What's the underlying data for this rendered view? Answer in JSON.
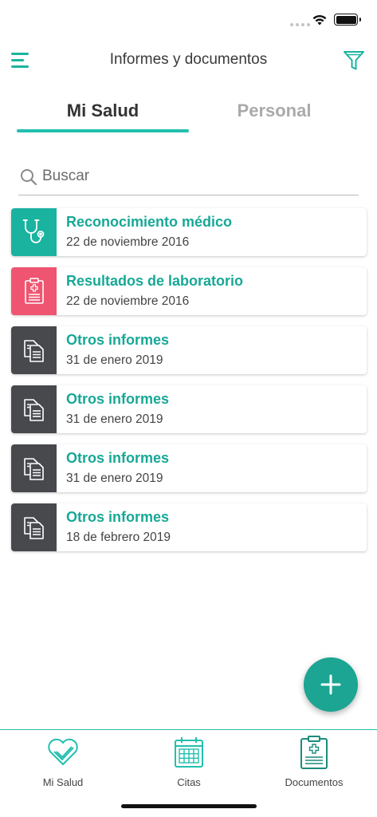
{
  "header": {
    "title": "Informes y documentos"
  },
  "tabs": [
    {
      "label": "Mi Salud",
      "active": true
    },
    {
      "label": "Personal",
      "active": false
    }
  ],
  "search": {
    "placeholder": "Buscar",
    "value": ""
  },
  "documents": [
    {
      "title": "Reconocimiento médico",
      "date": "22 de noviembre 2016",
      "icon": "stethoscope-icon",
      "color": "#1ab3a0"
    },
    {
      "title": "Resultados de laboratorio",
      "date": "22 de noviembre 2016",
      "icon": "clipboard-medical-icon",
      "color": "#ef5570"
    },
    {
      "title": "Otros informes",
      "date": "31 de enero 2019",
      "icon": "documents-icon",
      "color": "#47494d"
    },
    {
      "title": "Otros informes",
      "date": "31 de enero 2019",
      "icon": "documents-icon",
      "color": "#47494d"
    },
    {
      "title": "Otros informes",
      "date": "31 de enero 2019",
      "icon": "documents-icon",
      "color": "#47494d"
    },
    {
      "title": "Otros informes",
      "date": "18 de febrero 2019",
      "icon": "documents-icon",
      "color": "#47494d"
    }
  ],
  "fab": {
    "label": "+"
  },
  "tab_bar": [
    {
      "label": "Mi Salud",
      "icon": "heart-check-icon"
    },
    {
      "label": "Citas",
      "icon": "calendar-icon"
    },
    {
      "label": "Documentos",
      "icon": "clipboard-icon"
    }
  ],
  "colors": {
    "accent": "#1ab3a0",
    "fab": "#1ba592",
    "lab": "#ef5570",
    "dark": "#47494d"
  }
}
